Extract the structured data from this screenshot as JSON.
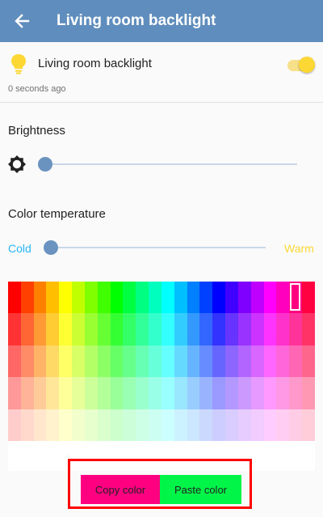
{
  "header": {
    "title": "Living room backlight",
    "back_icon": "arrow-left-icon"
  },
  "entity": {
    "name": "Living room backlight",
    "last_changed": "0 seconds ago",
    "icon": "lightbulb-icon",
    "state": "on",
    "toggle_color": "#fdd835"
  },
  "brightness": {
    "label": "Brightness",
    "icon": "brightness-icon",
    "level": 0.0
  },
  "color_temp": {
    "label": "Color temperature",
    "cold_label": "Cold",
    "warm_label": "Warm",
    "level": 0.0
  },
  "palette": {
    "columns": 24,
    "rows": 5,
    "selected_column": 22
  },
  "actions": {
    "copy_label": "Copy color",
    "paste_label": "Paste color",
    "copy_color": "#ff0080",
    "paste_color": "#00f548"
  },
  "colors": {
    "header": "#5f8dbd",
    "accent": "#6b93bf",
    "highlight_border": "#ff0000"
  }
}
